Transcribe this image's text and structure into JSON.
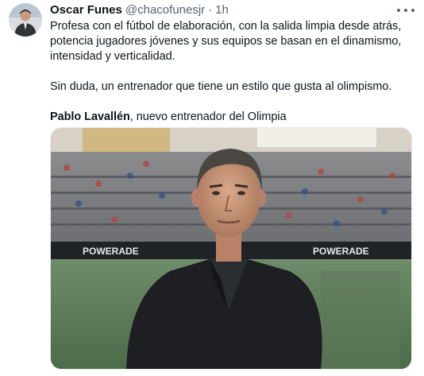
{
  "tweet": {
    "author_name": "Oscar Funes",
    "handle": "@chacofunesjr",
    "separator": "·",
    "time": "1h",
    "lines": [
      "Profesa con el fútbol de elaboración, con la salida limpia desde atrás,",
      "potencia jugadores jóvenes y sus equipos se basan en el dinamismo,",
      "intensidad y verticalidad."
    ],
    "paragraph2": "Sin duda, un entrenador que tiene un estilo que gusta al olimpismo.",
    "paragraph3_bold": "Pablo Lavallén",
    "paragraph3_rest": ", nuevo entrenador del Olimpia"
  },
  "media": {
    "ad_board_text": "POWERADE",
    "icon": "photo-of-coach"
  },
  "icons": {
    "avatar": "avatar-icon",
    "more": "more-options-icon"
  },
  "colors": {
    "name": "#0f1419",
    "meta": "#536471",
    "pitch": "#4f7a52",
    "ad_board": "#1f2328"
  }
}
